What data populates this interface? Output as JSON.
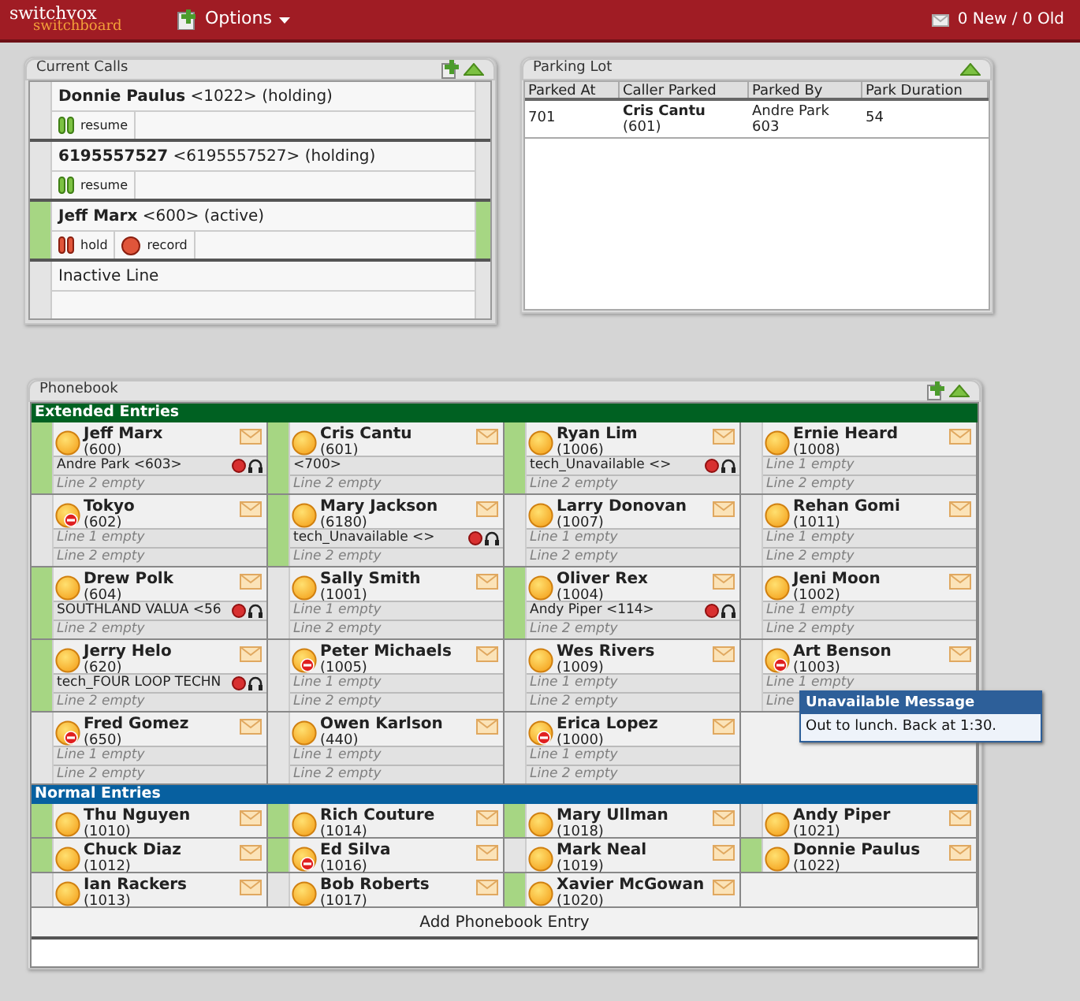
{
  "topbar": {
    "logo_top": "switchvox",
    "logo_bottom": "switchboard",
    "menu": "Options",
    "voicemail": "0 New / 0 Old"
  },
  "current_calls": {
    "title": "Current Calls",
    "calls": [
      {
        "kind": "call",
        "name": "Donnie Paulus",
        "detail": "<1022> (holding)",
        "active": false,
        "buttons": [
          {
            "label": "resume",
            "kind": "resume"
          }
        ]
      },
      {
        "kind": "call",
        "name": "6195557527",
        "detail": "<6195557527> (holding)",
        "active": false,
        "buttons": [
          {
            "label": "resume",
            "kind": "resume"
          }
        ]
      },
      {
        "kind": "call",
        "name": "Jeff Marx",
        "detail": "<600> (active)",
        "active": true,
        "buttons": [
          {
            "label": "hold",
            "kind": "hold"
          },
          {
            "label": "record",
            "kind": "record"
          }
        ]
      },
      {
        "kind": "inactive",
        "name": "Inactive Line"
      }
    ]
  },
  "parking_lot": {
    "title": "Parking Lot",
    "columns": [
      "Parked At",
      "Caller Parked",
      "Parked By",
      "Park Duration"
    ],
    "rows": [
      {
        "parked_at": "701",
        "caller_name": "Cris Cantu",
        "caller_ext": "(601)",
        "parked_by_name": "Andre Park",
        "parked_by_ext": "603",
        "duration": "54"
      }
    ]
  },
  "phonebook": {
    "title": "Phonebook",
    "sections": [
      {
        "kind": "extended",
        "title": "Extended Entries",
        "entries": [
          {
            "name": "Jeff Marx",
            "ext": "(600)",
            "unavailable": false,
            "on_call": true,
            "lines": [
              {
                "text": "Andre Park <603>",
                "kind": "active"
              },
              {
                "text": "Line 2 empty",
                "kind": "empty"
              }
            ]
          },
          {
            "name": "Cris Cantu",
            "ext": "(601)",
            "unavailable": false,
            "on_call": true,
            "lines": [
              {
                "text": "<700>",
                "kind": "call"
              },
              {
                "text": "Line 2 empty",
                "kind": "empty"
              }
            ]
          },
          {
            "name": "Ryan Lim",
            "ext": "(1006)",
            "unavailable": false,
            "on_call": true,
            "lines": [
              {
                "text": "tech_Unavailable <>",
                "kind": "active"
              },
              {
                "text": "Line 2 empty",
                "kind": "empty"
              }
            ]
          },
          {
            "name": "Ernie Heard",
            "ext": "(1008)",
            "unavailable": false,
            "on_call": false,
            "lines": [
              {
                "text": "Line 1 empty",
                "kind": "empty"
              },
              {
                "text": "Line 2 empty",
                "kind": "empty"
              }
            ]
          },
          {
            "name": "Tokyo",
            "ext": "(602)",
            "unavailable": true,
            "on_call": false,
            "lines": [
              {
                "text": "Line 1 empty",
                "kind": "empty"
              },
              {
                "text": "Line 2 empty",
                "kind": "empty"
              }
            ]
          },
          {
            "name": "Mary Jackson",
            "ext": "(6180)",
            "unavailable": false,
            "on_call": true,
            "lines": [
              {
                "text": "tech_Unavailable <>",
                "kind": "active"
              },
              {
                "text": "Line 2 empty",
                "kind": "empty"
              }
            ]
          },
          {
            "name": "Larry Donovan",
            "ext": "(1007)",
            "unavailable": false,
            "on_call": false,
            "lines": [
              {
                "text": "Line 1 empty",
                "kind": "empty"
              },
              {
                "text": "Line 2 empty",
                "kind": "empty"
              }
            ]
          },
          {
            "name": "Rehan Gomi",
            "ext": "(1011)",
            "unavailable": false,
            "on_call": false,
            "lines": [
              {
                "text": "Line 1 empty",
                "kind": "empty"
              },
              {
                "text": "Line 2 empty",
                "kind": "empty"
              }
            ]
          },
          {
            "name": "Drew Polk",
            "ext": "(604)",
            "unavailable": false,
            "on_call": true,
            "lines": [
              {
                "text": "SOUTHLAND VALUA <56",
                "kind": "active"
              },
              {
                "text": "Line 2 empty",
                "kind": "empty"
              }
            ]
          },
          {
            "name": "Sally Smith",
            "ext": "(1001)",
            "unavailable": false,
            "on_call": false,
            "lines": [
              {
                "text": "Line 1 empty",
                "kind": "empty"
              },
              {
                "text": "Line 2 empty",
                "kind": "empty"
              }
            ]
          },
          {
            "name": "Oliver Rex",
            "ext": "(1004)",
            "unavailable": false,
            "on_call": true,
            "lines": [
              {
                "text": "Andy Piper <114>",
                "kind": "active"
              },
              {
                "text": "Line 2 empty",
                "kind": "empty"
              }
            ]
          },
          {
            "name": "Jeni Moon",
            "ext": "(1002)",
            "unavailable": false,
            "on_call": false,
            "lines": [
              {
                "text": "Line 1 empty",
                "kind": "empty"
              },
              {
                "text": "Line 2 empty",
                "kind": "empty"
              }
            ]
          },
          {
            "name": "Jerry Helo",
            "ext": "(620)",
            "unavailable": false,
            "on_call": true,
            "lines": [
              {
                "text": "tech_FOUR LOOP TECHN",
                "kind": "active"
              },
              {
                "text": "Line 2 empty",
                "kind": "empty"
              }
            ]
          },
          {
            "name": "Peter Michaels",
            "ext": "(1005)",
            "unavailable": true,
            "on_call": false,
            "lines": [
              {
                "text": "Line 1 empty",
                "kind": "empty"
              },
              {
                "text": "Line 2 empty",
                "kind": "empty"
              }
            ]
          },
          {
            "name": "Wes Rivers",
            "ext": "(1009)",
            "unavailable": false,
            "on_call": false,
            "lines": [
              {
                "text": "Line 1 empty",
                "kind": "empty"
              },
              {
                "text": "Line 2 empty",
                "kind": "empty"
              }
            ]
          },
          {
            "name": "Art Benson",
            "ext": "(1003)",
            "unavailable": true,
            "on_call": false,
            "lines": [
              {
                "text": "Line 1 empty",
                "kind": "empty"
              },
              {
                "text": "Line",
                "kind": "empty"
              }
            ]
          },
          {
            "name": "Fred Gomez",
            "ext": "(650)",
            "unavailable": true,
            "on_call": false,
            "lines": [
              {
                "text": "Line 1 empty",
                "kind": "empty"
              },
              {
                "text": "Line 2 empty",
                "kind": "empty"
              }
            ]
          },
          {
            "name": "Owen Karlson",
            "ext": "(440)",
            "unavailable": false,
            "on_call": false,
            "lines": [
              {
                "text": "Line 1 empty",
                "kind": "empty"
              },
              {
                "text": "Line 2 empty",
                "kind": "empty"
              }
            ]
          },
          {
            "name": "Erica Lopez",
            "ext": "(1000)",
            "unavailable": true,
            "on_call": false,
            "lines": [
              {
                "text": "Line 1 empty",
                "kind": "empty"
              },
              {
                "text": "Line 2 empty",
                "kind": "empty"
              }
            ]
          }
        ]
      },
      {
        "kind": "normal",
        "title": "Normal Entries",
        "entries": [
          {
            "name": "Thu Nguyen",
            "ext": "(1010)",
            "unavailable": false,
            "on_call": true
          },
          {
            "name": "Rich Couture",
            "ext": "(1014)",
            "unavailable": false,
            "on_call": true
          },
          {
            "name": "Mary Ullman",
            "ext": "(1018)",
            "unavailable": false,
            "on_call": true
          },
          {
            "name": "Andy Piper",
            "ext": "(1021)",
            "unavailable": false,
            "on_call": false
          },
          {
            "name": "Chuck Diaz",
            "ext": "(1012)",
            "unavailable": false,
            "on_call": true
          },
          {
            "name": "Ed Silva",
            "ext": "(1016)",
            "unavailable": true,
            "on_call": true
          },
          {
            "name": "Mark Neal",
            "ext": "(1019)",
            "unavailable": false,
            "on_call": false
          },
          {
            "name": "Donnie Paulus",
            "ext": "(1022)",
            "unavailable": false,
            "on_call": true
          },
          {
            "name": "Ian Rackers",
            "ext": "(1013)",
            "unavailable": false,
            "on_call": false
          },
          {
            "name": "Bob Roberts",
            "ext": "(1017)",
            "unavailable": false,
            "on_call": false
          },
          {
            "name": "Xavier McGowan",
            "ext": "(1020)",
            "unavailable": false,
            "on_call": true
          }
        ]
      }
    ],
    "add_button": "Add Phonebook Entry"
  },
  "tooltip": {
    "title": "Unavailable Message",
    "message": "Out to lunch. Back at 1:30."
  }
}
